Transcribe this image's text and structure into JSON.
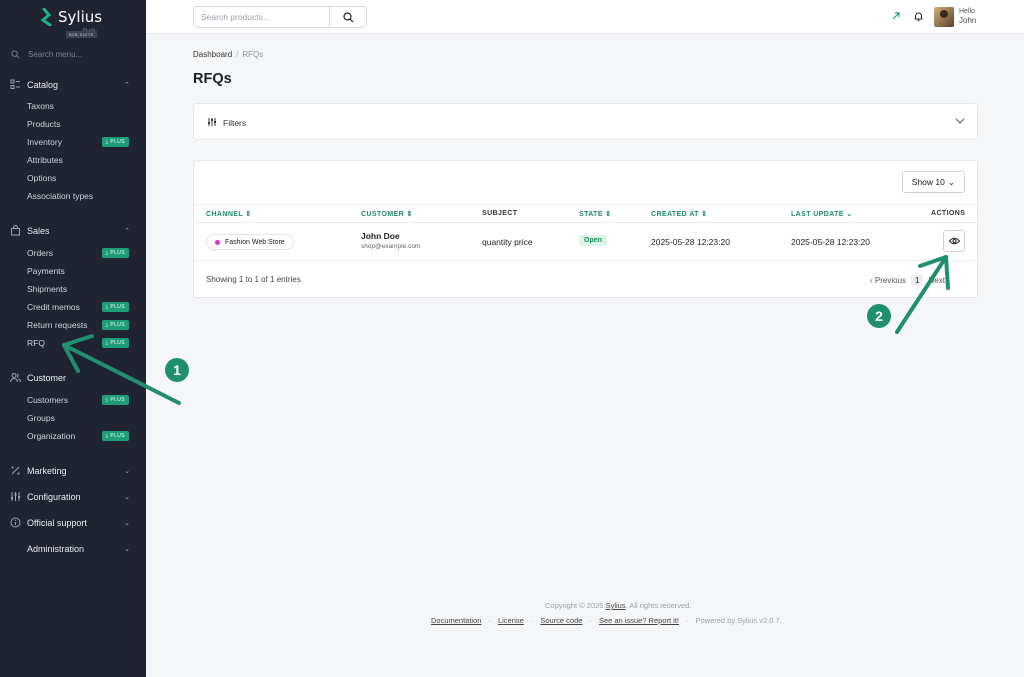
{
  "brand": {
    "name": "Sylius",
    "edition": "PLUS",
    "suite": "B2B SUITE"
  },
  "sidebar": {
    "search_placeholder": "Search menu...",
    "catalog": {
      "label": "Catalog",
      "items": [
        "Taxons",
        "Products",
        "Inventory",
        "Attributes",
        "Options",
        "Association types"
      ]
    },
    "sales": {
      "label": "Sales",
      "items": [
        "Orders",
        "Payments",
        "Shipments",
        "Credit memos",
        "Return requests",
        "RFQ"
      ]
    },
    "customer": {
      "label": "Customer",
      "items": [
        "Customers",
        "Groups",
        "Organization"
      ]
    },
    "marketing": "Marketing",
    "configuration": "Configuration",
    "support": "Official support",
    "administration": "Administration",
    "plus_badge": "PLUS"
  },
  "topbar": {
    "search_placeholder": "Search products...",
    "greeting": "Hello",
    "user": "John"
  },
  "breadcrumb": {
    "home": "Dashboard",
    "current": "RFQs"
  },
  "page_title": "RFQs",
  "filters_label": "Filters",
  "show_label": "Show 10",
  "table": {
    "headers": {
      "channel": "CHANNEL",
      "customer": "CUSTOMER",
      "subject": "SUBJECT",
      "state": "STATE",
      "created": "CREATED AT",
      "updated": "LAST UPDATE",
      "actions": "ACTIONS"
    },
    "rows": [
      {
        "channel": "Fashion Web Store",
        "customer_name": "John Doe",
        "customer_email": "shop@example.com",
        "subject": "quantity price",
        "state": "Open",
        "created": "2025-05-28 12:23:20",
        "updated": "2025-05-28 12:23:20"
      }
    ]
  },
  "entries_text": "Showing 1 to 1 of 1 entries",
  "pager": {
    "prev": "Previous",
    "page": "1",
    "next": "Next"
  },
  "footer": {
    "copyright_pre": "Copyright © 2025",
    "copyright_brand": "Sylius",
    "copyright_post": ". All rights reserved.",
    "links": [
      "Documentation",
      "License",
      "Source code",
      "See an issue? Report it!"
    ],
    "powered": "Powered by Sylius v2.0.7."
  },
  "annotations": {
    "marker_1": "1",
    "marker_2": "2"
  },
  "colors": {
    "sidebar_bg": "#1f2430",
    "accent": "#1f9c78",
    "annotation": "#1f8f6f",
    "channel_dot": "#e02fd2"
  }
}
